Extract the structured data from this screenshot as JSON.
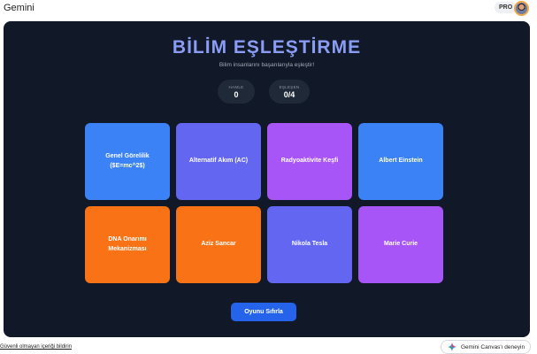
{
  "app": {
    "title": "Gemini",
    "badge": "PRO"
  },
  "game": {
    "title": "BİLİM EŞLEŞTİRME",
    "subtitle": "Bilim insanlarını başarılarıyla eşleştir!",
    "stats": {
      "moves_label": "HAMLE",
      "moves_value": "0",
      "matches_label": "EŞLEŞEN",
      "matches_value": "0/4"
    },
    "cards": [
      {
        "label": "Genel Görelilik ($E=mc^2$)",
        "color": "#3b82f6"
      },
      {
        "label": "Alternatif Akım (AC)",
        "color": "#6366f1"
      },
      {
        "label": "Radyoaktivite Keşfi",
        "color": "#a855f7"
      },
      {
        "label": "Albert Einstein",
        "color": "#3b82f6"
      },
      {
        "label": "DNA Onarımı Mekanizması",
        "color": "#f97316"
      },
      {
        "label": "Aziz Sancar",
        "color": "#f97316"
      },
      {
        "label": "Nikola Tesla",
        "color": "#6366f1"
      },
      {
        "label": "Marie Curie",
        "color": "#a855f7"
      }
    ],
    "reset_label": "Oyunu Sıfırla"
  },
  "footer": {
    "report_link": "Güvenli olmayan içeriği bildirin",
    "canvas_button": "Gemini Canvas'ı deneyin"
  }
}
